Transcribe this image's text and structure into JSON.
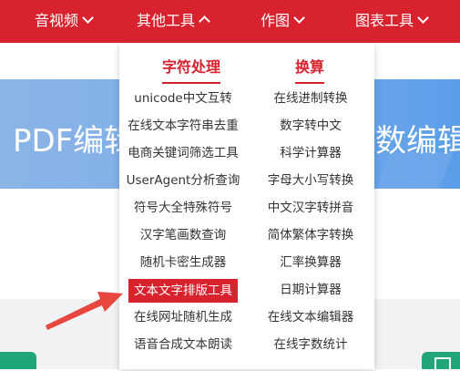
{
  "nav": {
    "items": [
      {
        "label": "音视频",
        "chevron": "down"
      },
      {
        "label": "其他工具",
        "chevron": "up"
      },
      {
        "label": "作图",
        "chevron": "down"
      },
      {
        "label": "图表工具",
        "chevron": "down"
      }
    ]
  },
  "banner": {
    "left_text": "PDF编辑",
    "right_text": "数编辑"
  },
  "dropdown": {
    "columns": [
      {
        "heading": "字符处理",
        "items": [
          "unicode中文互转",
          "在线文本字符串去重",
          "电商关键词筛选工具",
          "UserAgent分析查询",
          "符号大全特殊符号",
          "汉字笔画数查询",
          "随机卡密生成器",
          "文本文字排版工具",
          "在线网址随机生成",
          "语音合成文本朗读"
        ]
      },
      {
        "heading": "换算",
        "items": [
          "在线进制转换",
          "数字转中文",
          "科学计算器",
          "字母大小写转换",
          "中文汉字转拼音",
          "简体繁体字转换",
          "汇率换算器",
          "日期计算器",
          "在线文本编辑器",
          "在线字数统计"
        ]
      }
    ],
    "highlighted_item": "文本文字排版工具"
  },
  "colors": {
    "brand_red": "#d8232f",
    "green": "#21a67a",
    "arrow": "#e8473f"
  },
  "icons": {
    "arrow": "pointer-arrow-icon",
    "chevron": "chevron-icon"
  }
}
